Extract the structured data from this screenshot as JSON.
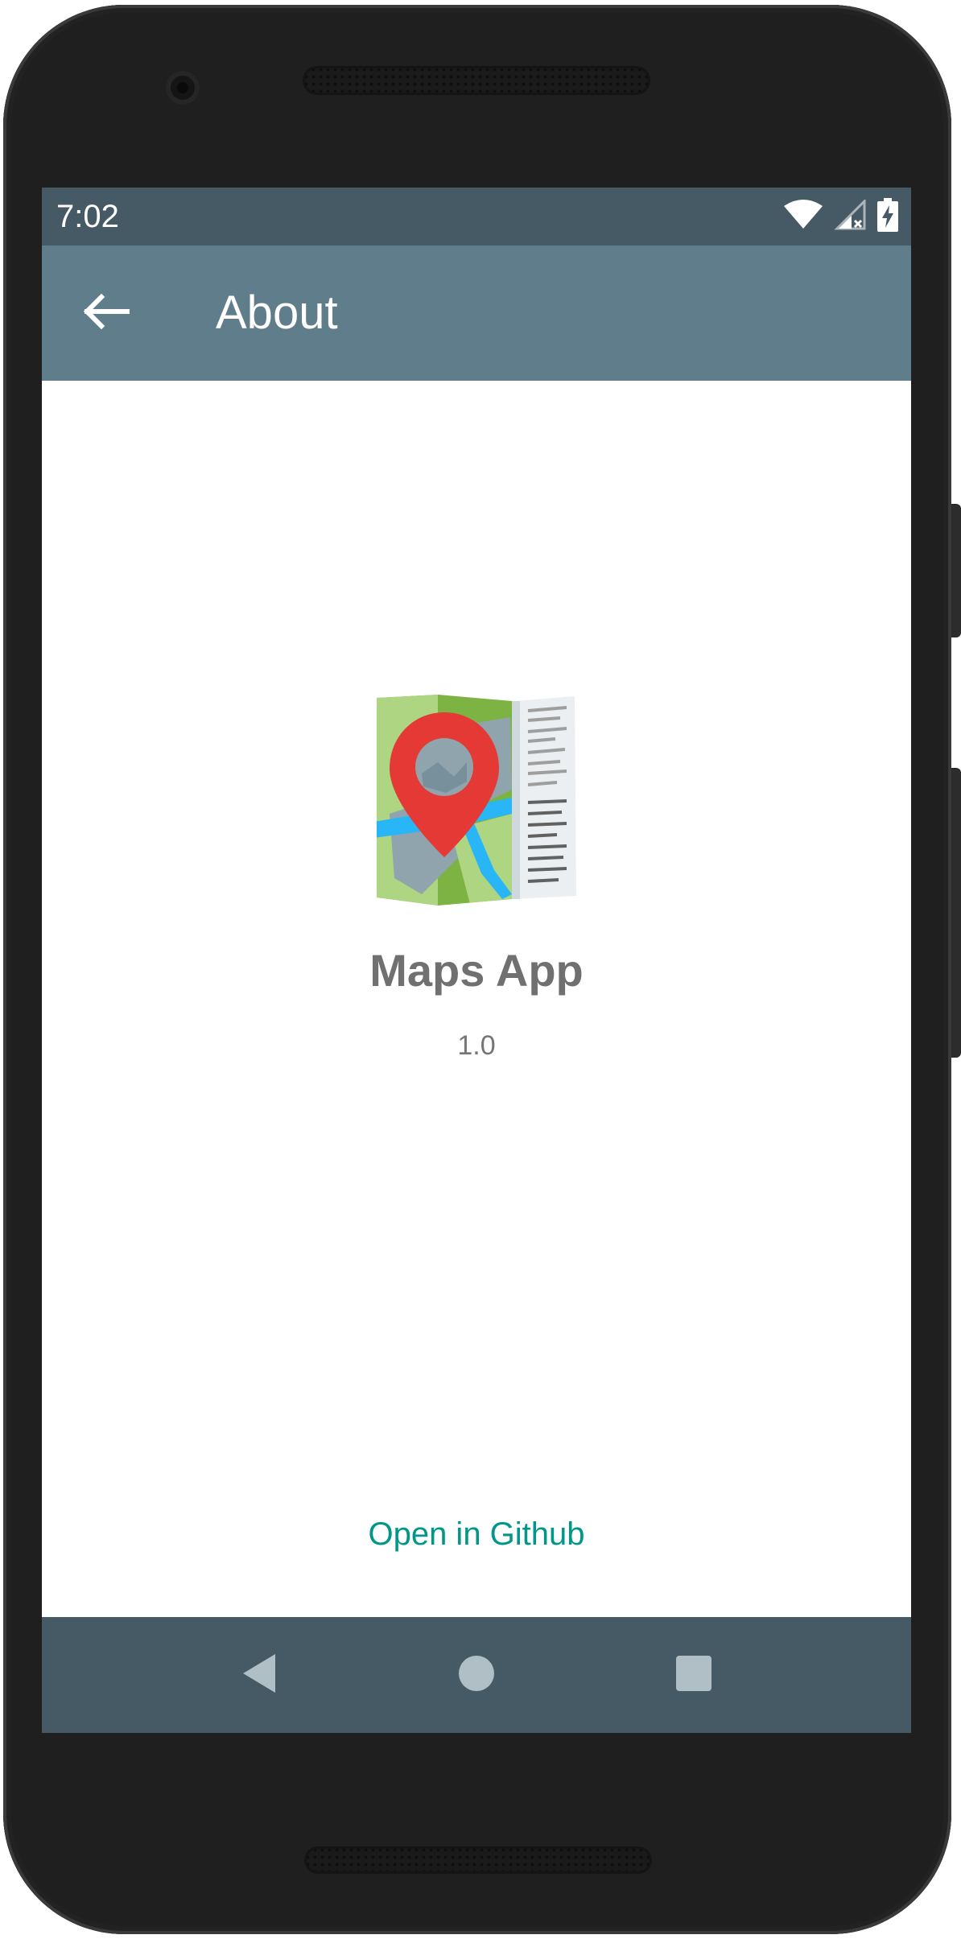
{
  "status_bar": {
    "time": "7:02",
    "icons": [
      "wifi-icon",
      "signal-icon",
      "battery-charging-icon"
    ]
  },
  "app_bar": {
    "back_icon": "arrow-left-icon",
    "title": "About"
  },
  "about": {
    "app_icon": "map-pin-icon",
    "app_name": "Maps App",
    "version": "1.0",
    "github_link": "Open in Github"
  },
  "nav_bar": {
    "buttons": [
      "back-triangle-icon",
      "home-circle-icon",
      "overview-square-icon"
    ]
  },
  "colors": {
    "status_bar": "#455a64",
    "app_bar": "#607d8b",
    "nav_bar": "#455a64",
    "link": "#009688",
    "pin": "#e53935"
  }
}
